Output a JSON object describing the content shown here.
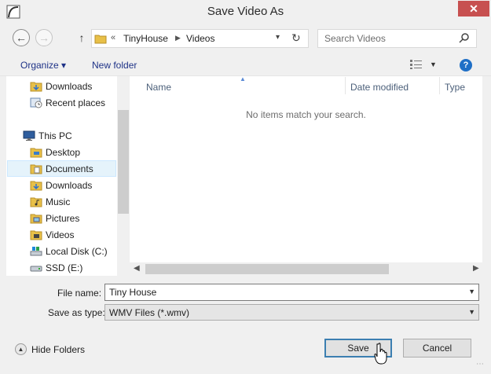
{
  "window": {
    "title": "Save Video As",
    "close_glyph": "✕"
  },
  "address": {
    "prefix": "«",
    "crumbs": [
      "TinyHouse",
      "Videos"
    ],
    "arrow": "▶",
    "dropdown": "▾",
    "refresh": "↻"
  },
  "search": {
    "placeholder": "Search Videos"
  },
  "toolbar": {
    "organize": "Organize ▾",
    "new_folder": "New folder",
    "view_dropdown": "▼",
    "help": "?"
  },
  "nav": {
    "items": [
      {
        "label": "Downloads",
        "icon": "download-folder-icon"
      },
      {
        "label": "Recent places",
        "icon": "recent-places-icon"
      },
      {
        "label": "This PC",
        "icon": "computer-icon"
      },
      {
        "label": "Desktop",
        "icon": "desktop-folder-icon"
      },
      {
        "label": "Documents",
        "icon": "documents-folder-icon"
      },
      {
        "label": "Downloads",
        "icon": "download-folder-icon"
      },
      {
        "label": "Music",
        "icon": "music-folder-icon"
      },
      {
        "label": "Pictures",
        "icon": "pictures-folder-icon"
      },
      {
        "label": "Videos",
        "icon": "videos-folder-icon"
      },
      {
        "label": "Local Disk (C:)",
        "icon": "local-disk-icon"
      },
      {
        "label": "SSD (E:)",
        "icon": "drive-icon"
      }
    ],
    "selected": "Documents"
  },
  "files": {
    "columns": [
      "Name",
      "Date modified",
      "Type"
    ],
    "empty_message": "No items match your search."
  },
  "form": {
    "filename_label": "File name:",
    "filename_value": "Tiny House",
    "type_label": "Save as type:",
    "type_value": "WMV Files (*.wmv)"
  },
  "footer": {
    "hide_folders": "Hide Folders",
    "save": "Save",
    "cancel": "Cancel"
  },
  "colors": {
    "accent": "#3c7fb1",
    "link": "#1e3287",
    "close": "#c75050",
    "selection": "#e5f3fb"
  }
}
